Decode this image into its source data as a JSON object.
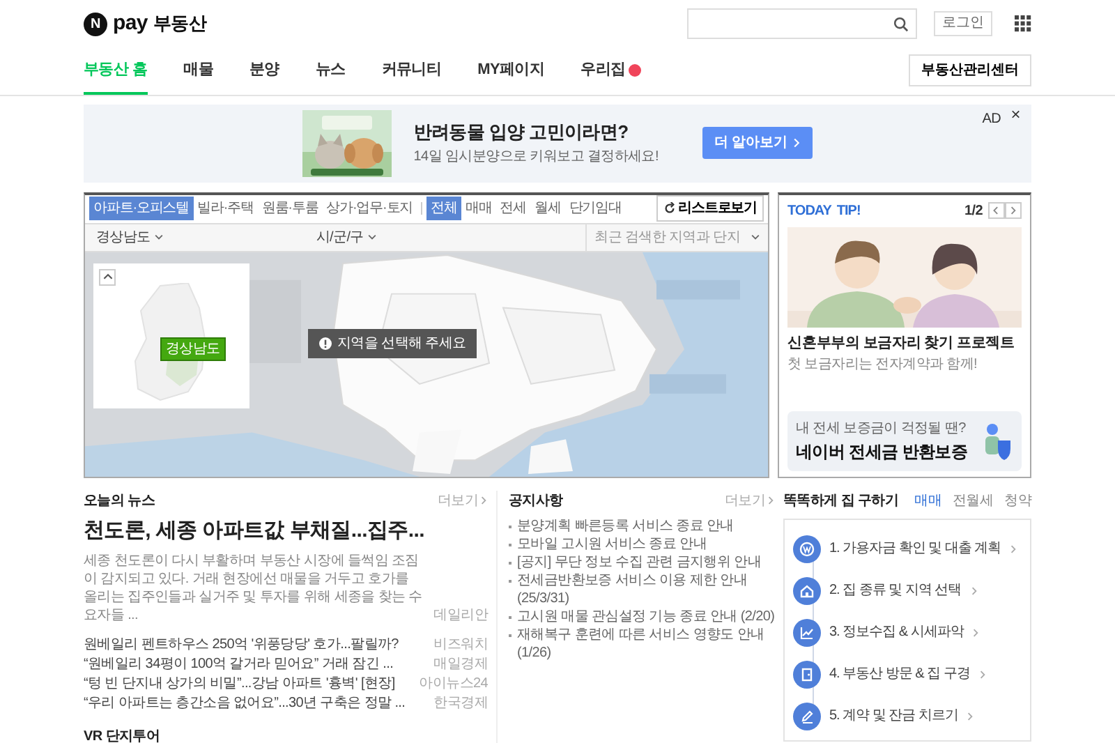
{
  "header": {
    "logo": {
      "badge": "N",
      "brand": "pay",
      "service": "부동산"
    },
    "login_button": "로그인"
  },
  "nav": {
    "tabs": [
      {
        "label": "부동산 홈",
        "selected": true,
        "new": false
      },
      {
        "label": "매물",
        "selected": false,
        "new": false
      },
      {
        "label": "분양",
        "selected": false,
        "new": false
      },
      {
        "label": "뉴스",
        "selected": false,
        "new": false
      },
      {
        "label": "커뮤니티",
        "selected": false,
        "new": false
      },
      {
        "label": "MY페이지",
        "selected": false,
        "new": false
      },
      {
        "label": "우리집",
        "selected": false,
        "new": true
      }
    ],
    "center_button": "부동산관리센터"
  },
  "ad": {
    "title": "반려동물 입양 고민이라면?",
    "subtitle": "14일 임시분양으로 키워보고 결정하세요!",
    "button": "더 알아보기",
    "label": "AD",
    "close": "×"
  },
  "map": {
    "property_types": [
      {
        "label": "아파트·오피스텔",
        "selected": true
      },
      {
        "label": "빌라·주택",
        "selected": false
      },
      {
        "label": "원룸·투룸",
        "selected": false
      },
      {
        "label": "상가·업무·토지",
        "selected": false
      }
    ],
    "deal_types": [
      {
        "label": "전체",
        "selected": true
      },
      {
        "label": "매매",
        "selected": false
      },
      {
        "label": "전세",
        "selected": false
      },
      {
        "label": "월세",
        "selected": false
      },
      {
        "label": "단기임대",
        "selected": false
      }
    ],
    "list_button": "리스트로보기",
    "region": "경상남도",
    "district": "시/군/구",
    "recent": "최근 검색한 지역과 단지",
    "minimap_label": "경상남도",
    "toast": "지역을 선택해 주세요"
  },
  "tip": {
    "label_a": "TODAY",
    "label_b": "TIP!",
    "page": "1/2",
    "title": "신혼부부의 보금자리 찾기 프로젝트",
    "subtitle": "첫 보금자리는 전자계약과 함께!",
    "banner": {
      "caption": "내 전세 보증금이 걱정될 땐?",
      "title": "네이버 전세금 반환보증"
    }
  },
  "news": {
    "title": "오늘의 뉴스",
    "more": "더보기",
    "headline": "천도론, 세종 아파트값 부채질...집주...",
    "summary": "세종 천도론이 다시 부활하며 부동산 시장에 들썩임 조짐이 감지되고 있다. 거래 현장에선 매물을 거두고 호가를 올리는 집주인들과 실거주 및 투자를 위해 세종을 찾는 수요자들 ...",
    "source": "데일리안",
    "items": [
      {
        "title": "원베일리 펜트하우스 250억 '위풍당당' 호가...팔릴까?",
        "source": "비즈워치"
      },
      {
        "title": "“원베일리 34평이 100억 갈거라 믿어요” 거래 잠긴 ...",
        "source": "매일경제"
      },
      {
        "title": "“텅 빈 단지내 상가의 비밀”...강남 아파트 '흉벽' [현장]",
        "source": "아이뉴스24"
      },
      {
        "title": "“우리 아파트는 층간소음 없어요”...30년 구축은 정말 ...",
        "source": "한국경제"
      }
    ]
  },
  "vr_title": "VR 단지투어",
  "notice": {
    "title": "공지사항",
    "more": "더보기",
    "items": [
      "분양계획 빠른등록 서비스 종료 안내",
      "모바일 고시원 서비스 종료 안내",
      "[공지] 무단 정보 수집 관련 금지행위 안내",
      "전세금반환보증 서비스 이용 제한 안내(25/3/31)",
      "고시원 매물 관심설정 기능 종료 안내 (2/20)",
      "재해복구 훈련에 따른 서비스 영향도 안내(1/26)"
    ]
  },
  "guide": {
    "title": "똑똑하게 집 구하기",
    "tabs": [
      {
        "label": "매매",
        "selected": true
      },
      {
        "label": "전월세",
        "selected": false
      },
      {
        "label": "청약",
        "selected": false
      }
    ],
    "steps": [
      {
        "kind": "money",
        "label": "1. 가용자금 확인 및 대출 계획"
      },
      {
        "kind": "home",
        "label": "2. 집 종류 및 지역 선택"
      },
      {
        "kind": "chart",
        "label": "3. 정보수집 & 시세파악"
      },
      {
        "kind": "visit",
        "label": "4. 부동산 방문 & 집 구경"
      },
      {
        "kind": "contract",
        "label": "5. 계약 및 잔금 치르기"
      }
    ]
  }
}
